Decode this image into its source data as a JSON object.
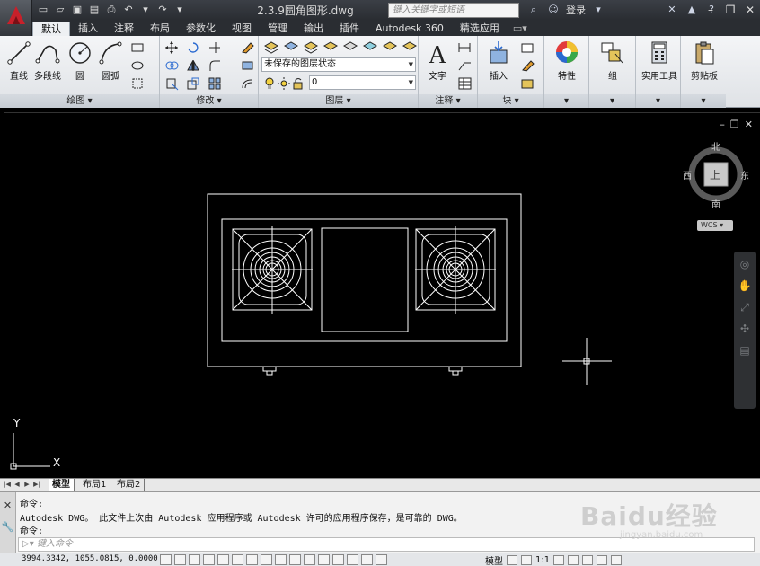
{
  "title_bar": {
    "document_title": "2.3.9圆角图形.dwg",
    "search_placeholder": "键入关键字或短语",
    "login_label": "登录",
    "help_label": "?"
  },
  "tabs": [
    "默认",
    "插入",
    "注释",
    "布局",
    "参数化",
    "视图",
    "管理",
    "输出",
    "插件",
    "Autodesk 360",
    "精选应用"
  ],
  "active_tab": "默认",
  "ribbon": {
    "panels": {
      "draw": "绘图",
      "modify": "修改",
      "layers": "图层",
      "annotation": "注释",
      "block": "块"
    },
    "draw_buttons": [
      "直线",
      "多段线",
      "圆",
      "圆弧"
    ],
    "layer_state_value": "未保存的图层状态",
    "layer_value": "0",
    "text_button": "文字",
    "insert_button": "插入",
    "properties_button": "特性",
    "group_button": "组",
    "utilities_button": "实用工具",
    "clipboard_button": "剪贴板"
  },
  "viewcube": {
    "north": "北",
    "south": "南",
    "east": "东",
    "west": "西",
    "top_face": "上",
    "wcs_label": "WCS"
  },
  "ucs": {
    "x_label": "X",
    "y_label": "Y"
  },
  "layout_tabs": [
    "模型",
    "布局1",
    "布局2"
  ],
  "active_layout": "模型",
  "command": {
    "lines": [
      "命令:",
      "Autodesk DWG。  此文件上次由 Autodesk 应用程序或 Autodesk 许可的应用程序保存，是可靠的 DWG。",
      "命令:"
    ],
    "input_placeholder": "键入命令"
  },
  "status": {
    "coordinates": "3994.3342, 1055.0815, 0.0000",
    "model_label": "模型",
    "scale_label": "1:1"
  },
  "watermark": {
    "text": "Baidu经验",
    "sub": "jingyan.baidu.com"
  },
  "colors": {
    "canvas": "#000000",
    "linework": "#ffffff",
    "app_red": "#c8202a",
    "ribbon": "#e6e8eb"
  }
}
